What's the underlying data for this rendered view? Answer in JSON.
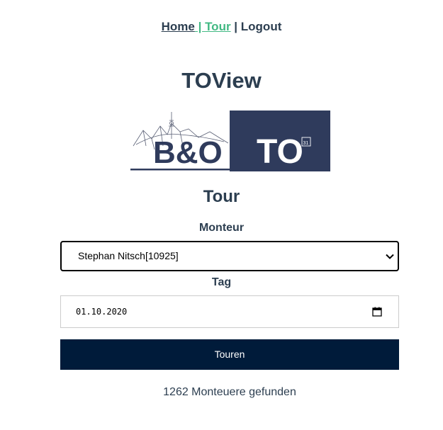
{
  "nav": {
    "home_label": "Home",
    "separator_1": " | ",
    "tour_label": "Tour",
    "separator_2": " | ",
    "logout_label": "Logout"
  },
  "page": {
    "title": "TOView",
    "subtitle": "Tour"
  },
  "logo": {
    "left_text": "B&O",
    "right_text": "TO",
    "calendar_badge": "31",
    "colors": {
      "navy": "#2f3b5c",
      "white": "#ffffff"
    }
  },
  "form": {
    "monteur_label": "Monteur",
    "monteur_value": "Stephan Nitsch[10925]",
    "tag_label": "Tag",
    "tag_value": "01.10.2020",
    "submit_label": "Touren"
  },
  "status": {
    "count_text": "1262 Monteuere gefunden"
  },
  "colors": {
    "text": "#2c3e50",
    "active_link": "#42b983",
    "button_bg": "#001b3a"
  },
  "icons": {
    "select": "chevron-down-icon",
    "date": "calendar-icon"
  }
}
